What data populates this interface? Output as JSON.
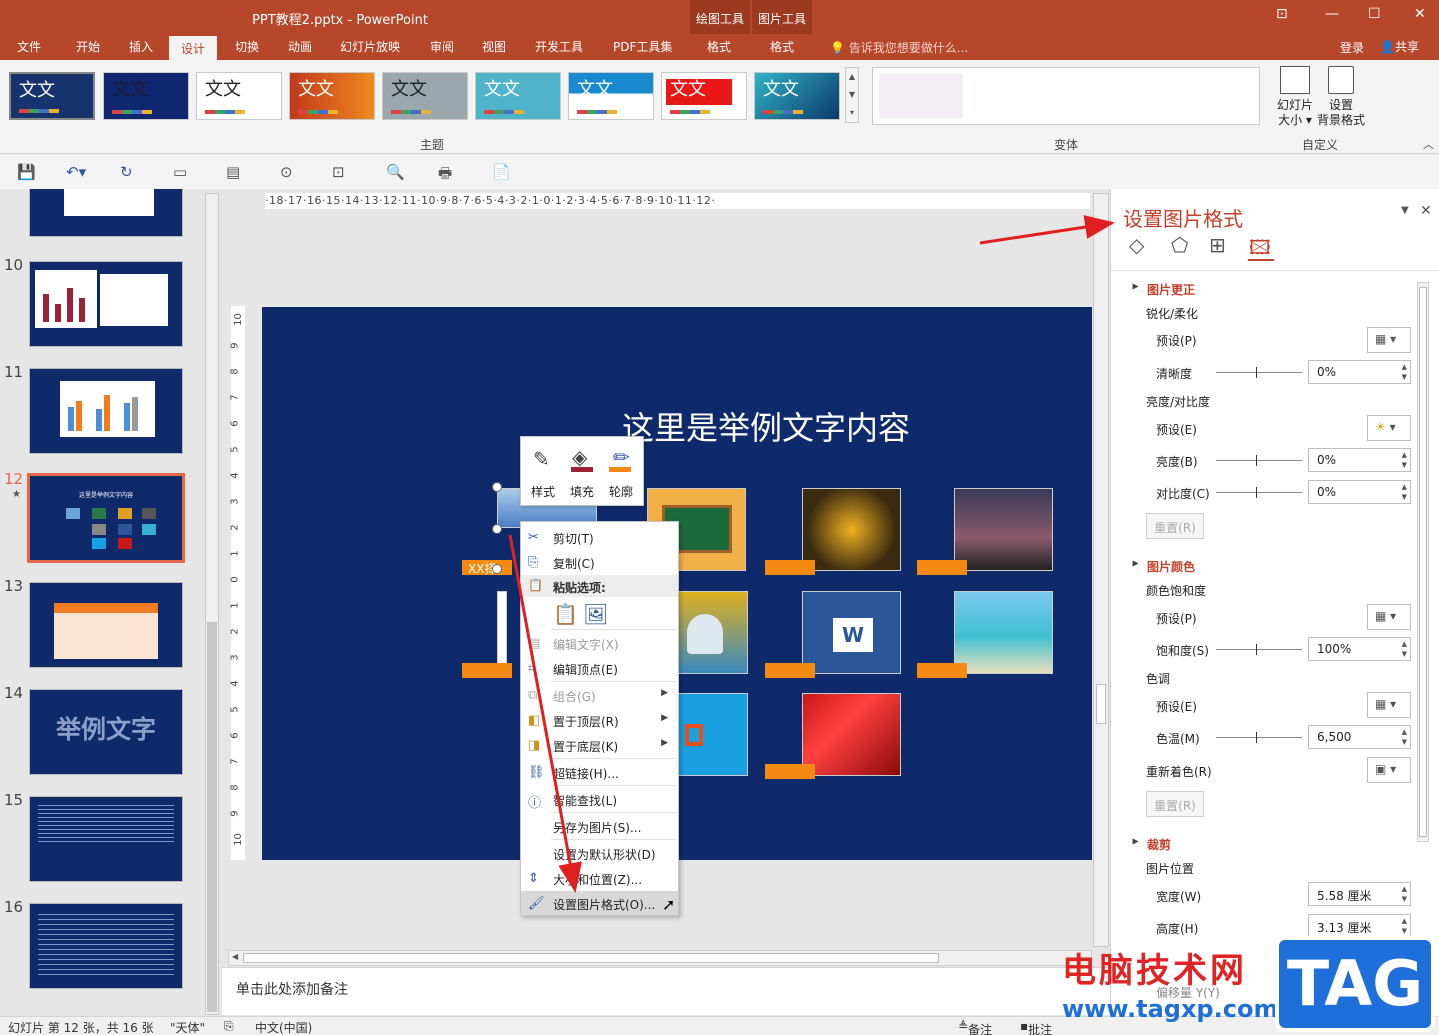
{
  "titlebar": {
    "title": "PPT教程2.pptx - PowerPoint",
    "ctx_drawing_tools": "绘图工具",
    "ctx_picture_tools": "图片工具"
  },
  "tabs": [
    {
      "label": "文件"
    },
    {
      "label": "开始"
    },
    {
      "label": "插入"
    },
    {
      "label": "设计"
    },
    {
      "label": "切换"
    },
    {
      "label": "动画"
    },
    {
      "label": "幻灯片放映"
    },
    {
      "label": "审阅"
    },
    {
      "label": "视图"
    },
    {
      "label": "开发工具"
    },
    {
      "label": "PDF工具集"
    },
    {
      "label": "格式"
    },
    {
      "label": "格式"
    }
  ],
  "tell_me": "告诉我您想要做什么...",
  "login": "登录",
  "share": "共享",
  "ribbon": {
    "theme_text": "文文",
    "themes_label": "主题",
    "variants_label": "变体",
    "customize_label": "自定义",
    "slide_size_line1": "幻灯片",
    "slide_size_line2": "大小",
    "bg_format_line1": "设置",
    "bg_format_line2": "背景格式"
  },
  "slides_panel": {
    "numbers": [
      "10",
      "11",
      "12",
      "13",
      "14",
      "15",
      "16"
    ],
    "slide12_title": "这里是举例文字内容",
    "slide14_text": "举例文字"
  },
  "ruler": {
    "horizontal": "·18·17·16·15·14·13·12·11·10·9·8·7·6·5·4·3·2·1·0·1·2·3·4·5·6·7·8·9·10·11·12·",
    "vertical": [
      "10",
      "9",
      "8",
      "7",
      "6",
      "5",
      "4",
      "3",
      "2",
      "1",
      "0",
      "1",
      "2",
      "3",
      "4",
      "5",
      "6",
      "7",
      "8",
      "9",
      "10"
    ]
  },
  "slide": {
    "title": "这里是举例文字内容",
    "label_text": "XX择"
  },
  "minibar": {
    "style": "样式",
    "fill": "填充",
    "outline": "轮廓"
  },
  "context_menu": {
    "cut": "剪切(T)",
    "copy": "复制(C)",
    "paste_header": "粘贴选项:",
    "edit_text": "编辑文字(X)",
    "edit_points": "编辑顶点(E)",
    "group": "组合(G)",
    "bring_front": "置于顶层(R)",
    "send_back": "置于底层(K)",
    "hyperlink": "超链接(H)...",
    "smart_lookup": "智能查找(L)",
    "save_as_pic": "另存为图片(S)...",
    "set_default": "设置为默认形状(D)",
    "size_position": "大小和位置(Z)...",
    "format_picture": "设置图片格式(O)..."
  },
  "notes_placeholder": "单击此处添加备注",
  "status": {
    "slide_info": "幻灯片 第 12 张，共 16 张",
    "theme": "\"天体\"",
    "language": "中文(中国)",
    "notes": "备注",
    "comments": "批注"
  },
  "format_pane": {
    "title": "设置图片格式",
    "sec_correction": "图片更正",
    "sharpen": "锐化/柔化",
    "preset1": "预设(P)",
    "clarity": "清晰度",
    "clarity_val": "0%",
    "brightness_contrast": "亮度/对比度",
    "preset2": "预设(E)",
    "brightness": "亮度(B)",
    "brightness_val": "0%",
    "contrast": "对比度(C)",
    "contrast_val": "0%",
    "reset1": "重置(R)",
    "sec_color": "图片颜色",
    "saturation_group": "颜色饱和度",
    "preset3": "预设(P)",
    "saturation": "饱和度(S)",
    "saturation_val": "100%",
    "tone": "色调",
    "preset4": "预设(E)",
    "temperature": "色温(M)",
    "temperature_val": "6,500",
    "recolor": "重新着色(R)",
    "reset2": "重置(R)",
    "sec_crop": "裁剪",
    "pic_position": "图片位置",
    "width": "宽度(W)",
    "width_val": "5.58 厘米",
    "height": "高度(H)",
    "height_val": "3.13 厘米",
    "offset_y": "偏移量 Y(Y)"
  },
  "watermark": {
    "text": "电脑技术网",
    "url": "www.tagxp.com",
    "tag": "TAG"
  },
  "colors": {
    "accent": "#b7472a",
    "slide_bg": "#0f2a6b",
    "label_orange": "#f58a12",
    "annotation_arrow": "#e02020"
  }
}
